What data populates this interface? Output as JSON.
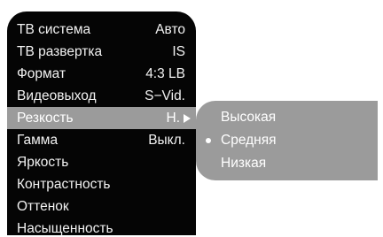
{
  "menu": {
    "items": [
      {
        "label": "ТВ система",
        "value": "Авто"
      },
      {
        "label": "ТВ развертка",
        "value": "IS"
      },
      {
        "label": "Формат",
        "value": "4:3 LB"
      },
      {
        "label": "Видеовыход",
        "value": "S−Vid."
      },
      {
        "label": "Резкость",
        "value": "H."
      },
      {
        "label": "Гамма",
        "value": "Выкл."
      },
      {
        "label": "Яркость",
        "value": ""
      },
      {
        "label": "Контрастность",
        "value": ""
      },
      {
        "label": "Оттенок",
        "value": ""
      },
      {
        "label": "Насыщенность",
        "value": ""
      }
    ],
    "selected_index": 4
  },
  "submenu": {
    "items": [
      {
        "label": "Высокая"
      },
      {
        "label": "Средняя"
      },
      {
        "label": "Низкая"
      }
    ],
    "active_index": 1
  },
  "colors": {
    "menu_background": "#050505",
    "highlight": "#9b9b9b",
    "text": "#f2f2f2"
  },
  "icons": {
    "submenu_arrow": "triangle-right-icon",
    "active_marker": "bullet-dot-icon"
  }
}
